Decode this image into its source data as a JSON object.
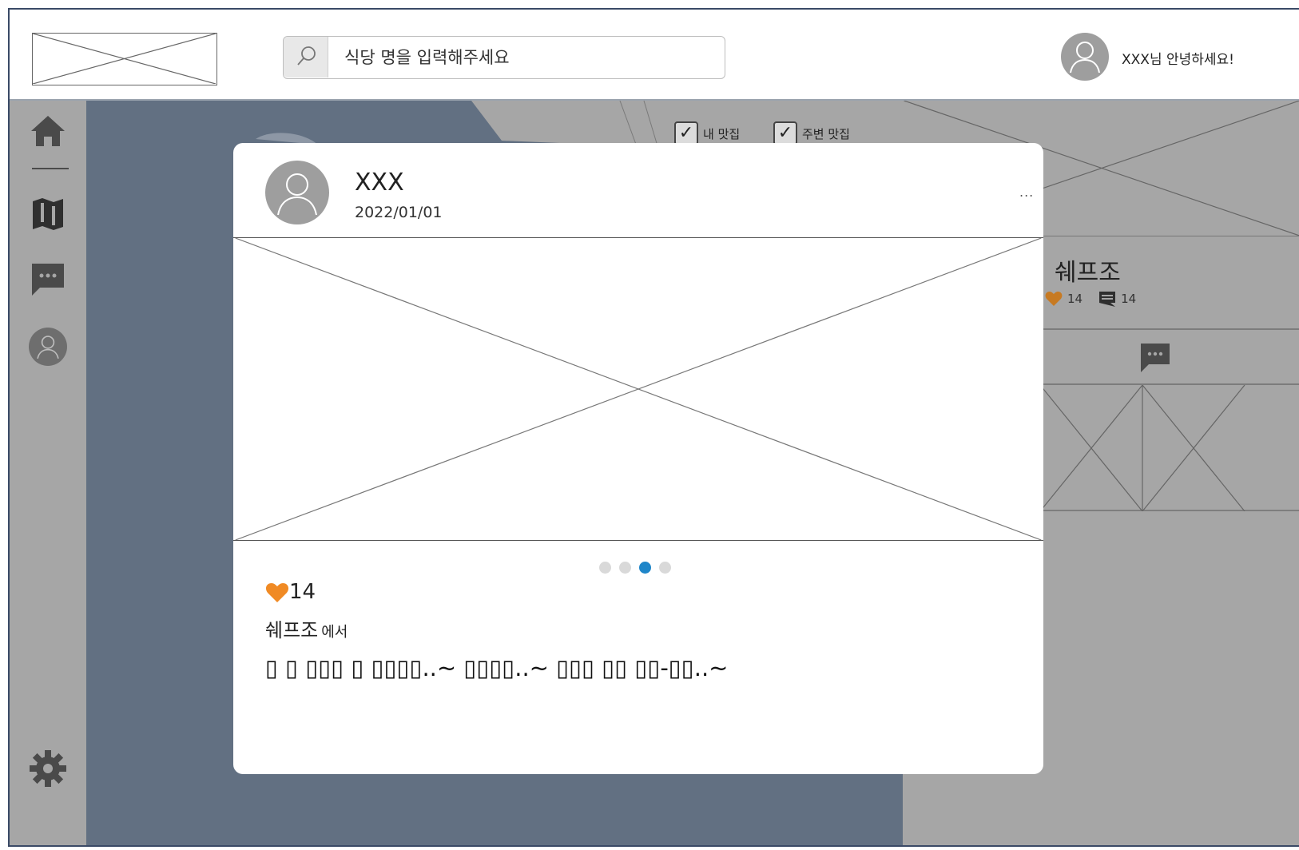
{
  "header": {
    "search_placeholder": "식당 명을 입력해주세요",
    "greeting": "XXX님 안녕하세요!"
  },
  "sidebar": {
    "items": [
      "home-icon",
      "map-icon",
      "chat-icon",
      "profile-icon"
    ],
    "bottom_item": "gear-icon"
  },
  "map": {
    "filters": [
      {
        "label": "내 맛집",
        "checked": true
      },
      {
        "label": "주변 맛집",
        "checked": true
      }
    ]
  },
  "right_panel": {
    "restaurant_name": "쉐프조",
    "likes": "14",
    "comments": "14"
  },
  "post": {
    "author": "XXX",
    "date": "2022/01/01",
    "more": "...",
    "likes": "14",
    "place": "쉐프조",
    "place_suffix": "에서",
    "text": "▯ ▯ ▯▯▯ ▯ ▯▯▯▯..~ ▯▯▯▯..~ ▯▯▯ ▯▯ ▯▯-▯▯..~",
    "carousel_dots": 4,
    "carousel_active": 3
  },
  "colors": {
    "accent_blue": "#1f86c9",
    "heart_orange": "#f08a24",
    "map_blue": "#627082",
    "panel_gray": "#a6a6a6"
  }
}
